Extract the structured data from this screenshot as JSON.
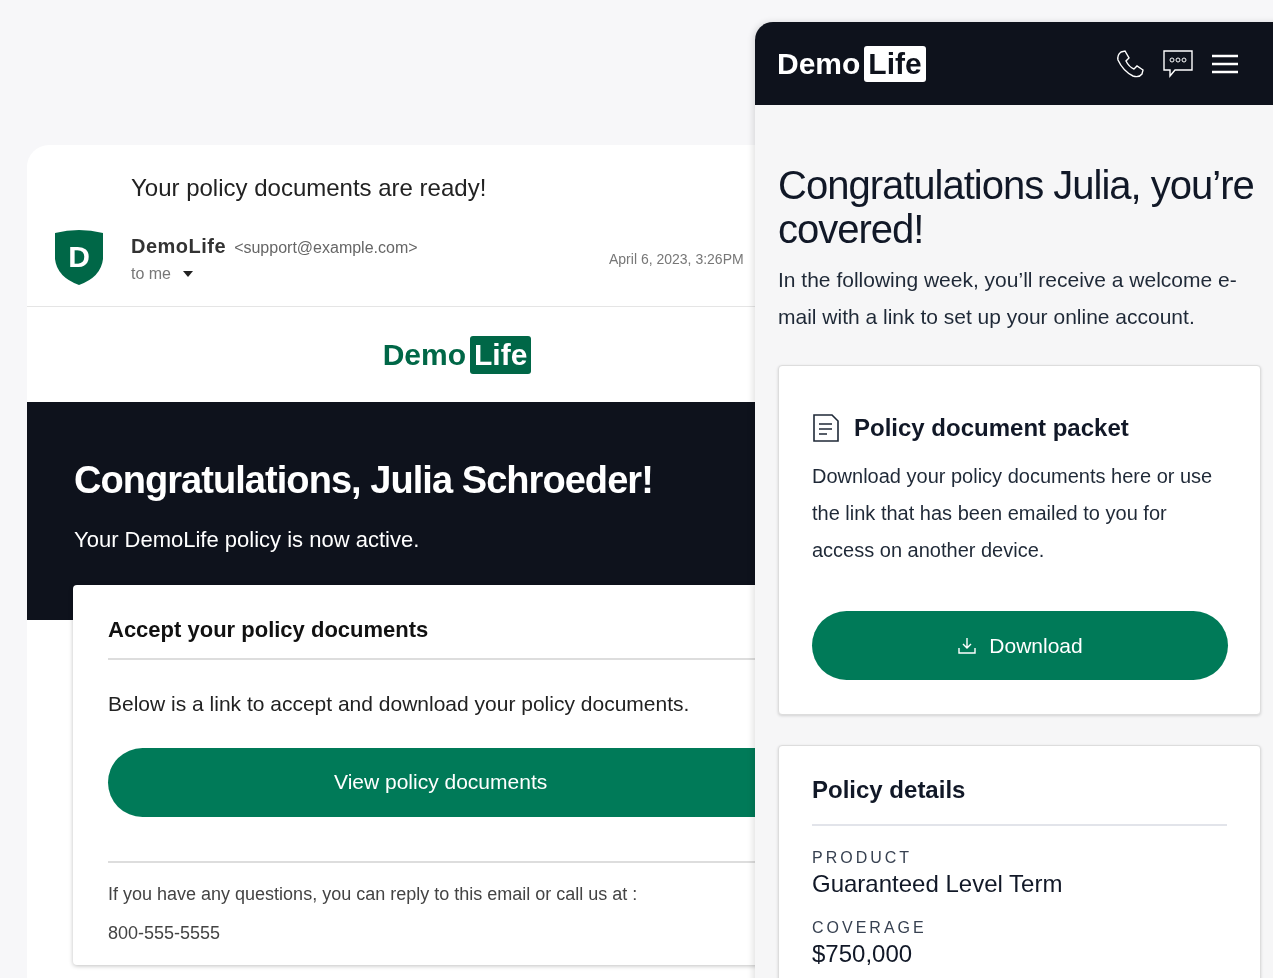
{
  "email": {
    "subject": "Your policy documents are ready!",
    "avatar_letter": "D",
    "sender_name": "DemoLife",
    "sender_address": "<support@example.com>",
    "recipient": "to me",
    "date": "April 6, 2023, 3:26PM",
    "logo": {
      "word": "Demo",
      "boxed": "Life"
    },
    "banner": {
      "title": "Congratulations, Julia Schroeder!",
      "subtitle": "Your DemoLife policy is now active."
    },
    "card": {
      "title": "Accept your policy documents",
      "text": "Below is a link to accept and download your policy documents.",
      "button": "View policy documents",
      "footer": "If you have any questions, you can reply to this email or call us at :",
      "phone": "800-555-5555"
    }
  },
  "app": {
    "logo": {
      "word": "Demo",
      "boxed": "Life"
    },
    "headline": "Congratulations Julia, you’re covered!",
    "intro": "In the following week, you’ll receive a welcome e-mail with a link to set up your online account.",
    "packet": {
      "title": "Policy document packet",
      "text": "Download your policy documents here or use the link that has been emailed to you for access on another device.",
      "button": "Download"
    },
    "details": {
      "title": "Policy details",
      "fields": [
        {
          "label": "PRODUCT",
          "value": "Guaranteed Level Term"
        },
        {
          "label": "COVERAGE",
          "value": "$750,000"
        }
      ]
    }
  }
}
